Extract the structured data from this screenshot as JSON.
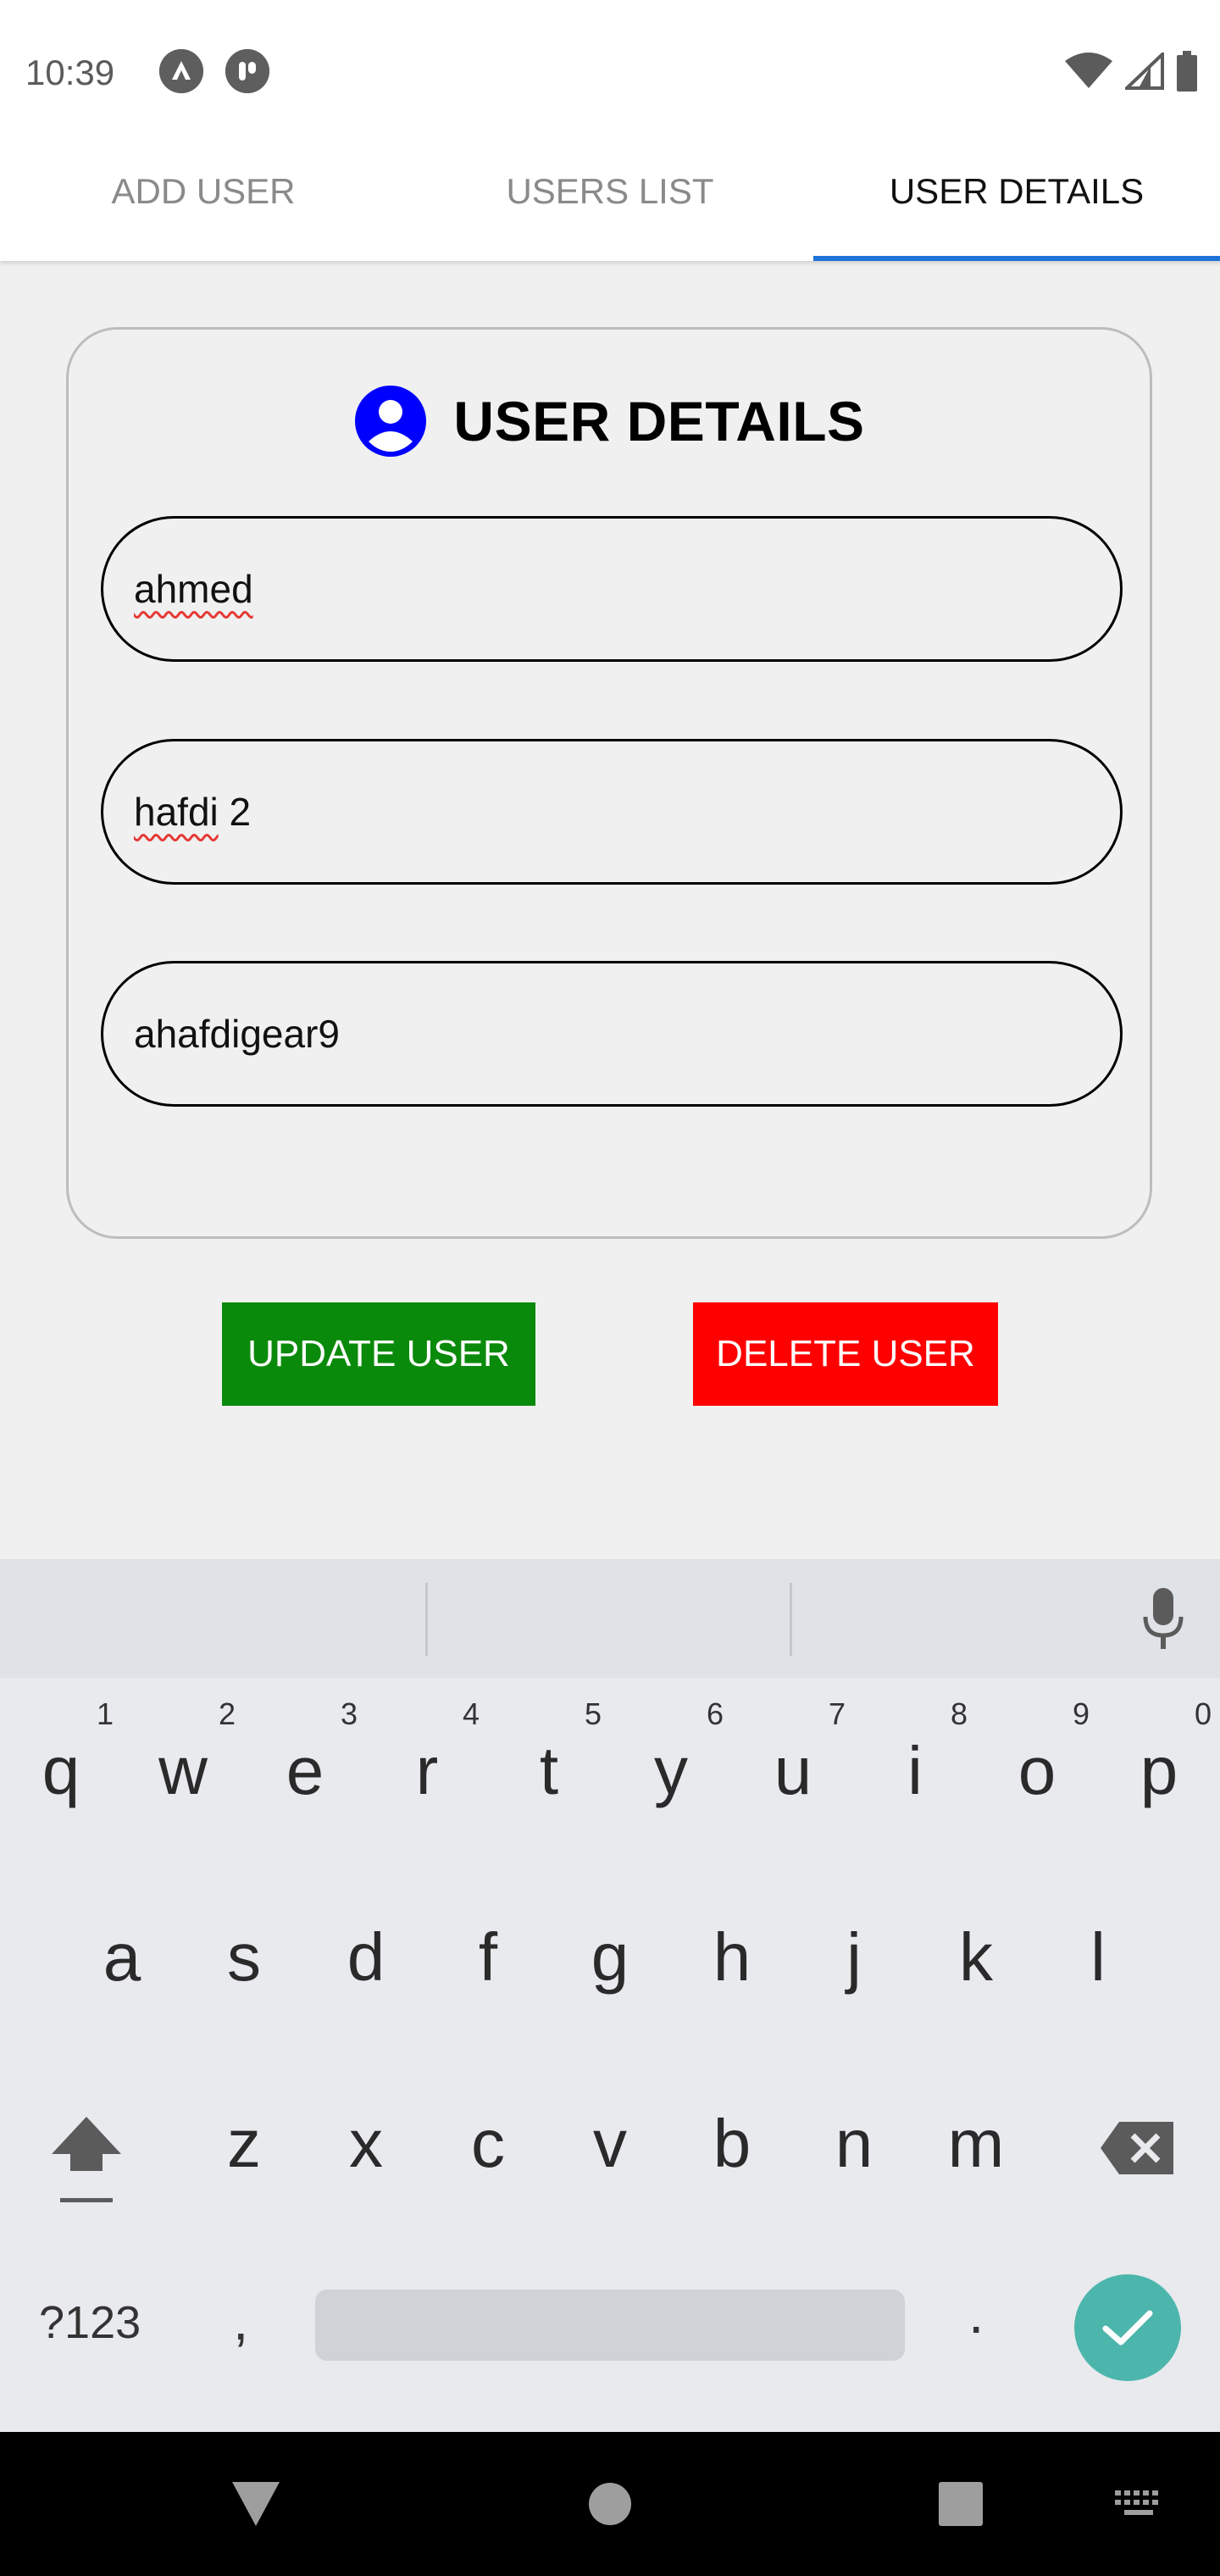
{
  "status_bar": {
    "time": "10:39",
    "left_icons": [
      "app-notification-icon-a",
      "app-notification-icon-b"
    ],
    "right_icons": [
      "wifi-icon",
      "signal-icon",
      "battery-icon"
    ]
  },
  "tabs": [
    {
      "label": "ADD USER",
      "active": false
    },
    {
      "label": "USERS LIST",
      "active": false
    },
    {
      "label": "USER DETAILS",
      "active": true
    }
  ],
  "card": {
    "icon": "user-circle-icon",
    "title": "USER DETAILS",
    "fields": [
      {
        "value": "ahmed"
      },
      {
        "value_part1": "hafdi",
        "value_part2": " 2"
      },
      {
        "value": "ahafdigear9"
      }
    ]
  },
  "buttons": {
    "update": "UPDATE USER",
    "delete": "DELETE USER"
  },
  "keyboard": {
    "row1": [
      {
        "key": "q",
        "hint": "1"
      },
      {
        "key": "w",
        "hint": "2"
      },
      {
        "key": "e",
        "hint": "3"
      },
      {
        "key": "r",
        "hint": "4"
      },
      {
        "key": "t",
        "hint": "5"
      },
      {
        "key": "y",
        "hint": "6"
      },
      {
        "key": "u",
        "hint": "7"
      },
      {
        "key": "i",
        "hint": "8"
      },
      {
        "key": "o",
        "hint": "9"
      },
      {
        "key": "p",
        "hint": "0"
      }
    ],
    "row2": [
      "a",
      "s",
      "d",
      "f",
      "g",
      "h",
      "j",
      "k",
      "l"
    ],
    "row3": [
      "z",
      "x",
      "c",
      "v",
      "b",
      "n",
      "m"
    ],
    "symbols_label": "?123",
    "comma": ",",
    "period": ".",
    "icons": [
      "mic-icon",
      "shift-icon",
      "backspace-icon",
      "check-icon"
    ]
  },
  "colors": {
    "accent": "#1e74d9",
    "update_button": "#0a8a0a",
    "delete_button": "#ff0000",
    "user_icon": "#0000ff",
    "enter_key": "#4db6ac"
  }
}
